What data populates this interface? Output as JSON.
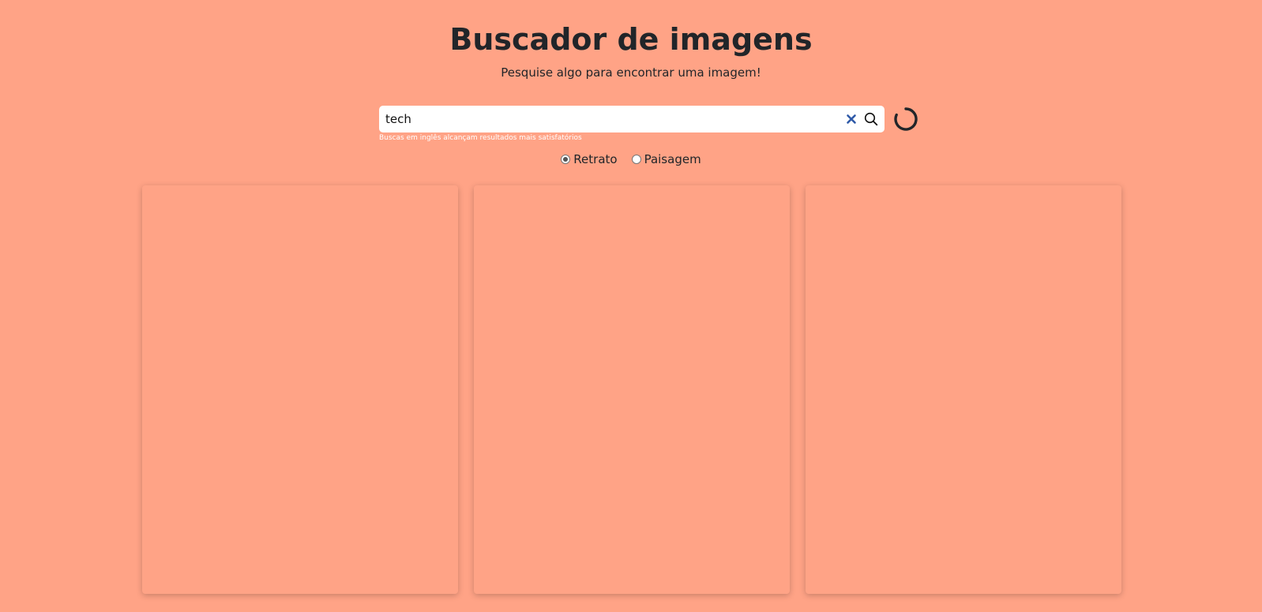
{
  "header": {
    "title": "Buscador de imagens",
    "subtitle": "Pesquise algo para encontrar uma imagem!"
  },
  "search": {
    "value": "tech",
    "placeholder": "",
    "hint": "Buscas em inglês alcançam resultados mais satisfatórios",
    "clear_icon": "close-icon",
    "search_icon": "search-icon",
    "loading_icon": "spinner-icon"
  },
  "orientation": {
    "options": [
      {
        "label": "Retrato",
        "checked": true
      },
      {
        "label": "Paisagem",
        "checked": false
      }
    ]
  },
  "results": {
    "cards": [
      {
        "state": "loading"
      },
      {
        "state": "loading"
      },
      {
        "state": "loading"
      }
    ]
  },
  "colors": {
    "background": "#ffa386",
    "text": "#212529",
    "clear_icon": "#2f5aa8",
    "hint": "#ffffff"
  }
}
